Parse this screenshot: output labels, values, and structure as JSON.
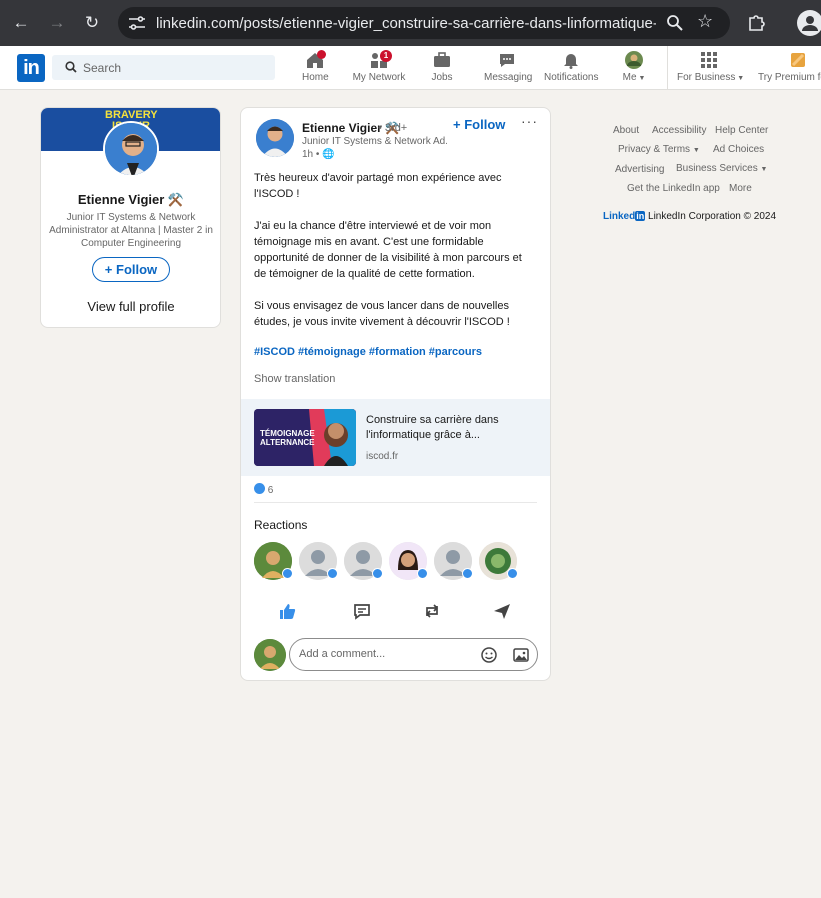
{
  "browser": {
    "url": "linkedin.com/posts/etienne-vigier_construire-sa-carrière-dans-linformatique-a..."
  },
  "header": {
    "search_placeholder": "Search",
    "nav": [
      {
        "label": "Home",
        "badge": ""
      },
      {
        "label": "My Network",
        "badge": "1"
      },
      {
        "label": "Jobs",
        "badge": ""
      },
      {
        "label": "Messaging",
        "badge": ""
      },
      {
        "label": "Notifications",
        "badge": ""
      },
      {
        "label": "Me",
        "badge": ""
      },
      {
        "label": "For Business",
        "badge": ""
      },
      {
        "label": "Try Premium fo",
        "badge": ""
      }
    ]
  },
  "profile_card": {
    "banner_text": "BRAVERY IS OUR THIS",
    "name": "Etienne Vigier ⚒️",
    "headline_1": "Junior IT Systems & Network",
    "headline_2": "Administrator at Altanna | Master 2 in",
    "headline_3": "Computer Engineering",
    "follow_label": "Follow",
    "view_profile": "View full profile"
  },
  "post": {
    "author": "Etienne Vigier ⚒️",
    "degree": "• 3rd+",
    "headline": "Junior IT Systems & Network Ad...",
    "time": "1h •",
    "follow_label": "Follow",
    "more": "···",
    "text": [
      "Très heureux d'avoir partagé mon expérience avec",
      "l'ISCOD !",
      "",
      "J'ai eu la chance d'être interviewé et de voir mon",
      "témoignage mis en avant. C'est une formidable",
      "opportunité de donner de la visibilité à mon parcours et",
      "de témoigner de la qualité de cette formation.",
      "",
      "Si vous envisagez de vous lancer dans de nouvelles",
      "études, je vous invite vivement à découvrir l'ISCOD !"
    ],
    "hashtags": "#ISCOD #témoignage #formation #parcours",
    "show_translation": "Show translation",
    "link": {
      "thumb_text": "TÉMOIGNAGE ALTERNANCE",
      "title_1": "Construire sa carrière dans",
      "title_2": "l'informatique grâce à...",
      "domain": "iscod.fr"
    },
    "reaction_count": "6",
    "reactions_heading": "Reactions",
    "comment_placeholder": "Add a comment..."
  },
  "footer": {
    "about": "About",
    "accessibility": "Accessibility",
    "help": "Help Center",
    "privacy": "Privacy & Terms",
    "adchoices": "Ad Choices",
    "advertising": "Advertising",
    "business": "Business Services",
    "app": "Get the LinkedIn app",
    "more": "More",
    "brand": "Linked",
    "copyright": "LinkedIn Corporation © 2024"
  },
  "colors": {
    "accent": "#0a66c2",
    "badge": "#cb112d",
    "background": "#f4f2ee"
  }
}
